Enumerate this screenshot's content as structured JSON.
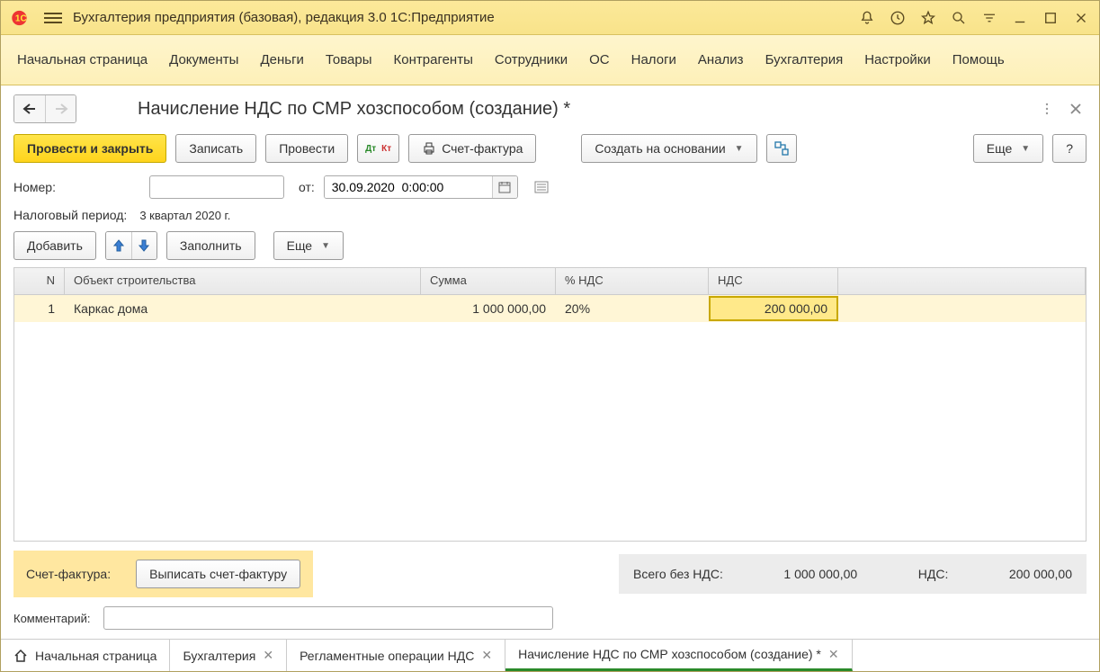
{
  "titlebar": {
    "title": "Бухгалтерия предприятия (базовая), редакция 3.0 1С:Предприятие"
  },
  "menu": {
    "items": [
      "Начальная страница",
      "Документы",
      "Деньги",
      "Товары",
      "Контрагенты",
      "Сотрудники",
      "ОС",
      "Налоги",
      "Анализ",
      "Бухгалтерия",
      "Настройки",
      "Помощь"
    ]
  },
  "page": {
    "title": "Начисление НДС по СМР хозспособом (создание) *"
  },
  "toolbar": {
    "post_close": "Провести и закрыть",
    "save": "Записать",
    "post": "Провести",
    "invoice": "Счет-фактура",
    "create_based": "Создать на основании",
    "more": "Еще",
    "help": "?"
  },
  "form": {
    "number_label": "Номер:",
    "number_value": "",
    "from_label": "от:",
    "date_value": "30.09.2020  0:00:00",
    "tax_period_label": "Налоговый период:",
    "tax_period_value": "3 квартал 2020 г."
  },
  "table_toolbar": {
    "add": "Добавить",
    "fill": "Заполнить",
    "more": "Еще"
  },
  "table": {
    "headers": {
      "n": "N",
      "obj": "Объект строительства",
      "sum": "Сумма",
      "vatpct": "% НДС",
      "nds": "НДС"
    },
    "rows": [
      {
        "n": "1",
        "obj": "Каркас дома",
        "sum": "1 000 000,00",
        "vatpct": "20%",
        "nds": "200 000,00"
      }
    ]
  },
  "invoice": {
    "label": "Счет-фактура:",
    "button": "Выписать счет-фактуру"
  },
  "summary": {
    "total_label": "Всего без НДС:",
    "total_value": "1 000 000,00",
    "nds_label": "НДС:",
    "nds_value": "200 000,00"
  },
  "comment": {
    "label": "Комментарий:",
    "value": ""
  },
  "tabs": {
    "items": [
      {
        "label": "Начальная страница",
        "home": true,
        "closable": false,
        "active": false
      },
      {
        "label": "Бухгалтерия",
        "closable": true,
        "active": false
      },
      {
        "label": "Регламентные операции НДС",
        "closable": true,
        "active": false
      },
      {
        "label": "Начисление НДС по СМР хозспособом (создание) *",
        "closable": true,
        "active": true
      }
    ]
  }
}
